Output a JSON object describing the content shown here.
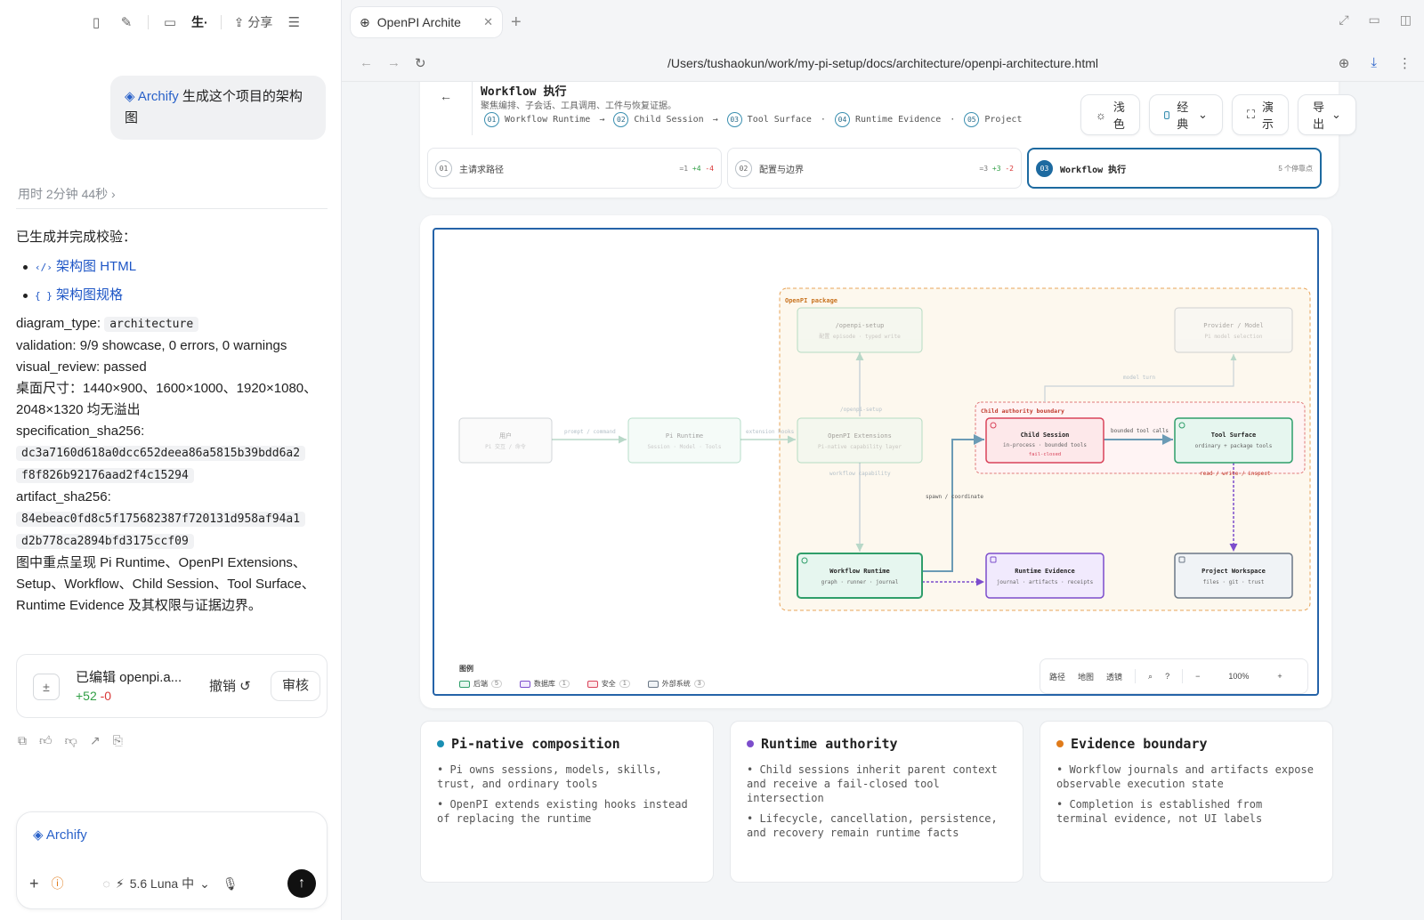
{
  "left": {
    "toolbar": {
      "folder_label": "生·",
      "share_label": "分享"
    },
    "user_message": {
      "tag": "Archify",
      "text": " 生成这个项目的架构图"
    },
    "elapsed": "用时 2分钟 44秒 ›",
    "reply": {
      "intro": "已生成并完成校验：",
      "links": [
        {
          "icon": "‹/›",
          "label": "架构图 HTML"
        },
        {
          "icon": "{ }",
          "label": "架构图规格"
        }
      ],
      "diagram_type_label": "diagram_type: ",
      "diagram_type_value": "architecture",
      "validation": "validation: 9/9 showcase, 0 errors, 0 warnings",
      "visual_review": "visual_review: passed",
      "desktop_sizes": "桌面尺寸：1440×900、1600×1000、1920×1080、2048×1320 均无溢出",
      "spec_sha_label": "specification_sha256:",
      "spec_sha_1": "dc3a7160d618a0dcc652deea86a5815b39bdd6a2",
      "spec_sha_2": "f8f826b92176aad2f4c15294",
      "artifact_sha_label": "artifact_sha256:",
      "artifact_sha_1": "84ebeac0fd8c5f175682387f720131d958af94a1",
      "artifact_sha_2": "d2b778ca2894bfd3175ccf09",
      "summary": "图中重点呈现 Pi Runtime、OpenPI Extensions、Setup、Workflow、Child Session、Tool Surface、Runtime Evidence 及其权限与证据边界。"
    },
    "edit_card": {
      "title": "已编辑 openpi.a...",
      "added": "+52",
      "removed": "-0",
      "undo": "撤销 ↺",
      "review": "审核"
    },
    "composer": {
      "chip": "Archify",
      "model": "5.6 Luna 中"
    }
  },
  "browser": {
    "tab_title": "OpenPI Archite",
    "url": "/Users/tushaokun/work/my-pi-setup/docs/architecture/openpi-architecture.html"
  },
  "page": {
    "header": {
      "title": "Workflow 执行",
      "subtitle": "聚焦编排、子会话、工具调用、工件与恢复证据。",
      "steps": [
        {
          "num": "01",
          "label": "Workflow Runtime"
        },
        {
          "num": "02",
          "label": "Child Session"
        },
        {
          "num": "03",
          "label": "Tool Surface"
        },
        {
          "num": "04",
          "label": "Runtime Evidence"
        },
        {
          "num": "05",
          "label": "Project"
        }
      ],
      "buttons": {
        "theme": "浅色",
        "style": "经典",
        "present": "演示",
        "export": "导出"
      }
    },
    "pills": [
      {
        "num": "01",
        "label": "主请求路径",
        "meta": "=1",
        "plus": "+4",
        "minus": "-4"
      },
      {
        "num": "02",
        "label": "配置与边界",
        "meta": "=3",
        "plus": "+3",
        "minus": "-2"
      },
      {
        "num": "03",
        "label": "Workflow 执行",
        "meta": "5 个停靠点",
        "plus": "",
        "minus": ""
      }
    ],
    "diagram": {
      "package_label": "OpenPI package",
      "boundary_label": "Child authority boundary",
      "nodes": {
        "user": {
          "title": "用户",
          "sub": "Pi 交互 / 命令"
        },
        "pi_runtime": {
          "title": "Pi Runtime",
          "sub": "Session · Model · Tools"
        },
        "extensions": {
          "title": "OpenPI Extensions",
          "sub": "Pi-native capability layer"
        },
        "setup": {
          "title": "/openpi-setup",
          "sub": "配置 episode · typed write"
        },
        "provider": {
          "title": "Provider / Model",
          "sub": "Pi model selection"
        },
        "child": {
          "title": "Child Session",
          "sub": "in-process · bounded tools",
          "extra": "fail-closed"
        },
        "tool": {
          "title": "Tool Surface",
          "sub": "ordinary + package tools"
        },
        "workflow": {
          "title": "Workflow Runtime",
          "sub": "graph · runner · journal"
        },
        "evidence": {
          "title": "Runtime Evidence",
          "sub": "journal · artifacts · receipts"
        },
        "workspace": {
          "title": "Project Workspace",
          "sub": "files · git · trust"
        }
      },
      "edges": {
        "prompt": "prompt / command",
        "hooks": "extension hooks",
        "setup": "/openpi-setup",
        "capability": "workflow capability",
        "spawn": "spawn / coordinate",
        "calls": "bounded tool calls",
        "model": "model turn",
        "rwi": "read / write / inspect"
      },
      "legend": {
        "title": "图例",
        "items": [
          {
            "label": "后端",
            "count": "5",
            "color": "#2f9e6a"
          },
          {
            "label": "数据库",
            "count": "1",
            "color": "#7c4dcc"
          },
          {
            "label": "安全",
            "count": "1",
            "color": "#d9435a"
          },
          {
            "label": "外部系统",
            "count": "3",
            "color": "#6b7785"
          }
        ]
      },
      "zoombar": {
        "path": "路径",
        "map": "地图",
        "lens": "透镜",
        "zoom": "100%"
      }
    },
    "cards": [
      {
        "title": "Pi-native composition",
        "color": "#1a8fb3",
        "bullets": [
          "• Pi owns sessions, models, skills, trust, and ordinary tools",
          "• OpenPI extends existing hooks instead of replacing the runtime"
        ]
      },
      {
        "title": "Runtime authority",
        "color": "#7c4dcc",
        "bullets": [
          "• Child sessions inherit parent context and receive a fail-closed tool intersection",
          "• Lifecycle, cancellation, persistence, and recovery remain runtime facts"
        ]
      },
      {
        "title": "Evidence boundary",
        "color": "#e07b1a",
        "bullets": [
          "• Workflow journals and artifacts expose observable execution state",
          "• Completion is established from terminal evidence, not UI labels"
        ]
      }
    ]
  }
}
